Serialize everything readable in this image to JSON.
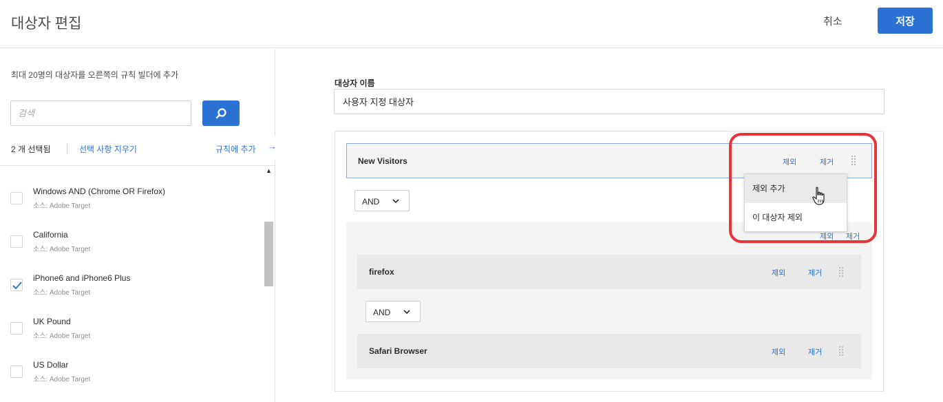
{
  "header": {
    "title": "대상자 편집",
    "cancel_label": "취소",
    "save_label": "저장"
  },
  "left": {
    "instructions": "최대 20명의 대상자를 오른쪽의 규칙 빌더에 추가",
    "search_placeholder": "검색",
    "selected_count": "2 개 선택됨",
    "clear_selection": "선택 사항 지우기",
    "add_to_rule": "규칙에 추가",
    "add_to_rule_arrow": "→",
    "items": [
      {
        "name": "Windows AND (Chrome OR Firefox)",
        "source": "소스: Adobe Target",
        "checked": false
      },
      {
        "name": "California",
        "source": "소스: Adobe Target",
        "checked": false
      },
      {
        "name": "iPhone6 and iPhone6 Plus",
        "source": "소스: Adobe Target",
        "checked": true
      },
      {
        "name": "UK Pound",
        "source": "소스: Adobe Target",
        "checked": false
      },
      {
        "name": "US Dollar",
        "source": "소스: Adobe Target",
        "checked": false
      }
    ]
  },
  "right": {
    "audience_name_label": "대상자 이름",
    "audience_name_value": "사용자 지정 대상자",
    "top_card": {
      "title": "New Visitors",
      "exclude": "제외",
      "remove": "제거"
    },
    "and_label": "AND",
    "group": {
      "exclude": "제외",
      "remove": "제거"
    },
    "inner_cards": [
      {
        "title": "firefox",
        "exclude": "제외",
        "remove": "제거"
      },
      {
        "title": "Safari Browser",
        "exclude": "제외",
        "remove": "제거"
      }
    ],
    "inner_and_label": "AND",
    "menu": {
      "items": [
        "제외 추가",
        "이 대상자 제외"
      ]
    }
  },
  "colors": {
    "accent": "#2c72d4",
    "highlight": "#e8333b"
  }
}
